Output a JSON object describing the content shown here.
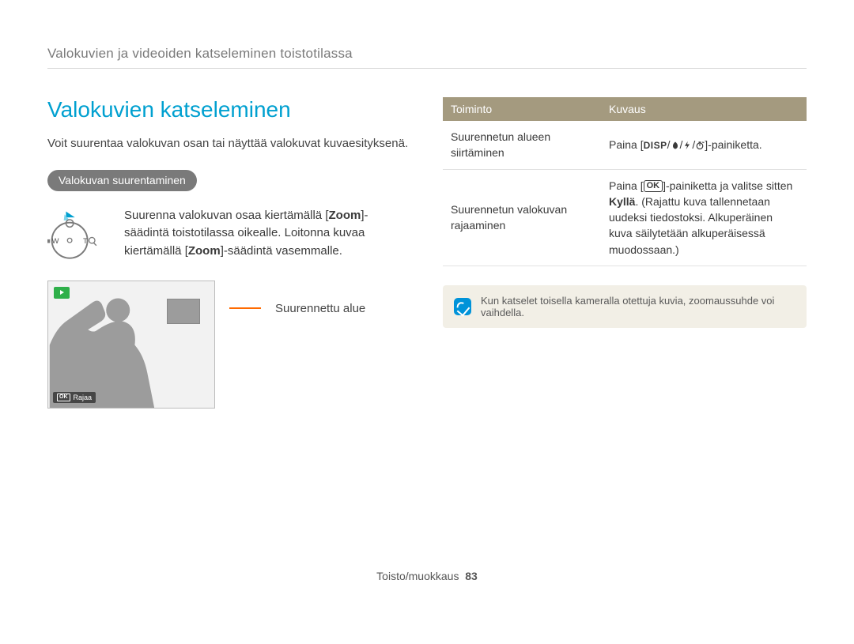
{
  "breadcrumb": "Valokuvien ja videoiden katseleminen toistotilassa",
  "heading": "Valokuvien katseleminen",
  "lead": "Voit suurentaa valokuvan osan tai näyttää valokuvat kuvaesityksenä.",
  "pill": "Valokuvan suurentaminen",
  "dial": {
    "W": "W",
    "T": "T"
  },
  "zoom_desc": {
    "pre1": "Suurenna valokuvan osaa kiertämällä [",
    "zoom1": "Zoom",
    "mid1": "]-säädintä toistotilassa oikealle. Loitonna kuvaa kiertämällä [",
    "zoom2": "Zoom",
    "post": "]-säädintä vasemmalle."
  },
  "preview": {
    "crop_ok": "OK",
    "crop_label": "Rajaa",
    "zoom_area_label": "Suurennettu alue"
  },
  "table": {
    "head": {
      "col1": "Toiminto",
      "col2": "Kuvaus"
    },
    "rows": [
      {
        "func": "Suurennetun alueen siirtäminen",
        "desc_pre": "Paina [",
        "disp": "DISP",
        "sep": "/",
        "desc_post": "]-painiketta."
      },
      {
        "func": "Suurennetun valokuvan rajaaminen",
        "desc_pre": "Paina [",
        "ok": "OK",
        "mid1": "]-painiketta ja valitse sitten ",
        "bold": "Kyllä",
        "mid2": ". (Rajattu kuva tallennetaan uudeksi tiedostoksi. Alkuperäinen kuva säilytetään alkuperäisessä muodossaan.)"
      }
    ]
  },
  "note": "Kun katselet toisella kameralla otettuja kuvia, zoomaussuhde voi vaihdella.",
  "footer": {
    "section": "Toisto/muokkaus",
    "page": "83"
  }
}
